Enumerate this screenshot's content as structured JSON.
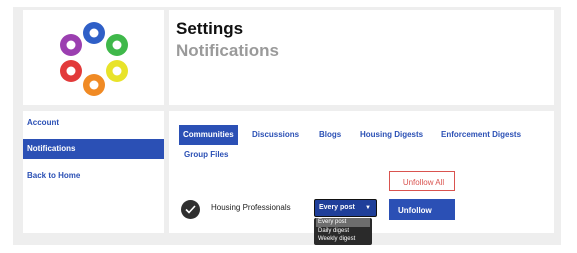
{
  "header": {
    "title": "Settings",
    "subtitle": "Notifications"
  },
  "sidebar": {
    "items": [
      {
        "label": "Account"
      },
      {
        "label": "Notifications",
        "active": true
      },
      {
        "label": "Back to Home"
      }
    ]
  },
  "tabs": [
    {
      "label": "Communities",
      "active": true
    },
    {
      "label": "Discussions"
    },
    {
      "label": "Blogs"
    },
    {
      "label": "Housing Digests"
    },
    {
      "label": "Enforcement Digests"
    },
    {
      "label": "Group Files"
    }
  ],
  "unfollow_all_label": "Unfollow All",
  "community": {
    "name": "Housing Professionals",
    "frequency": {
      "selected": "Every post",
      "options": [
        "Every post",
        "Daily digest",
        "Weekly digest"
      ]
    },
    "unfollow_label": "Unfollow"
  },
  "icons": {
    "logo": "people-circle-logo",
    "status": "check-icon",
    "dropdown": "chevron-down-icon"
  },
  "colors": {
    "accent": "#2b50b5",
    "danger": "#d9534f",
    "logo_purple": "#9b3fb0",
    "logo_blue": "#2f5fc7",
    "logo_green": "#3fb84a",
    "logo_yellow": "#e8e32a",
    "logo_orange": "#f08a24",
    "logo_red": "#e23a3a"
  }
}
